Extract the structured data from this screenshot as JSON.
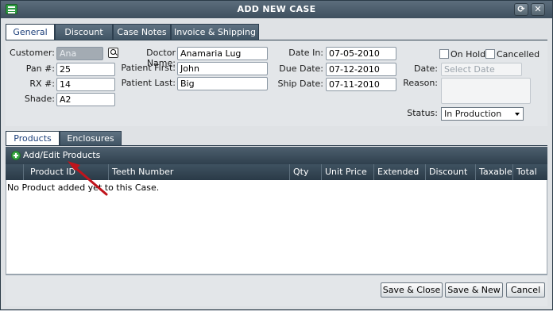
{
  "window": {
    "title": "ADD NEW CASE"
  },
  "top_tabs": [
    "General",
    "Discount",
    "Case Notes",
    "Invoice & Shipping"
  ],
  "form": {
    "customer_label": "Customer:",
    "customer_value": "Ana",
    "pan_label": "Pan #:",
    "pan_value": "25",
    "rx_label": "RX #:",
    "rx_value": "14",
    "shade_label": "Shade:",
    "shade_value": "A2",
    "doctor_label": "Doctor Name:",
    "doctor_value": "Anamaria Lug",
    "patient_first_label": "Patient First:",
    "patient_first_value": "John",
    "patient_last_label": "Patient Last:",
    "patient_last_value": "Big",
    "date_in_label": "Date In:",
    "date_in_value": "07-05-2010",
    "due_date_label": "Due Date:",
    "due_date_value": "07-12-2010",
    "ship_date_label": "Ship Date:",
    "ship_date_value": "07-11-2010",
    "on_hold_label": "On Hold",
    "cancelled_label": "Cancelled",
    "date_label": "Date:",
    "date_placeholder": "Select Date",
    "reason_label": "Reason:",
    "status_label": "Status:",
    "status_value": "In Production"
  },
  "sub_tabs": [
    "Products",
    "Enclosures"
  ],
  "toolbar": {
    "add_label": "Add/Edit Products"
  },
  "grid": {
    "columns": [
      "Product ID",
      "Teeth Number",
      "Qty",
      "Unit Price",
      "Extended",
      "Discount",
      "Taxable",
      "Total"
    ],
    "empty_message": "No Product added yet to this Case."
  },
  "footer": {
    "save_close": "Save & Close",
    "save_new": "Save & New",
    "cancel": "Cancel"
  },
  "colors": {
    "title_bar": "#3e4f5e",
    "grid_header": "#2a3a47",
    "annotation_arrow": "#c0141c"
  }
}
